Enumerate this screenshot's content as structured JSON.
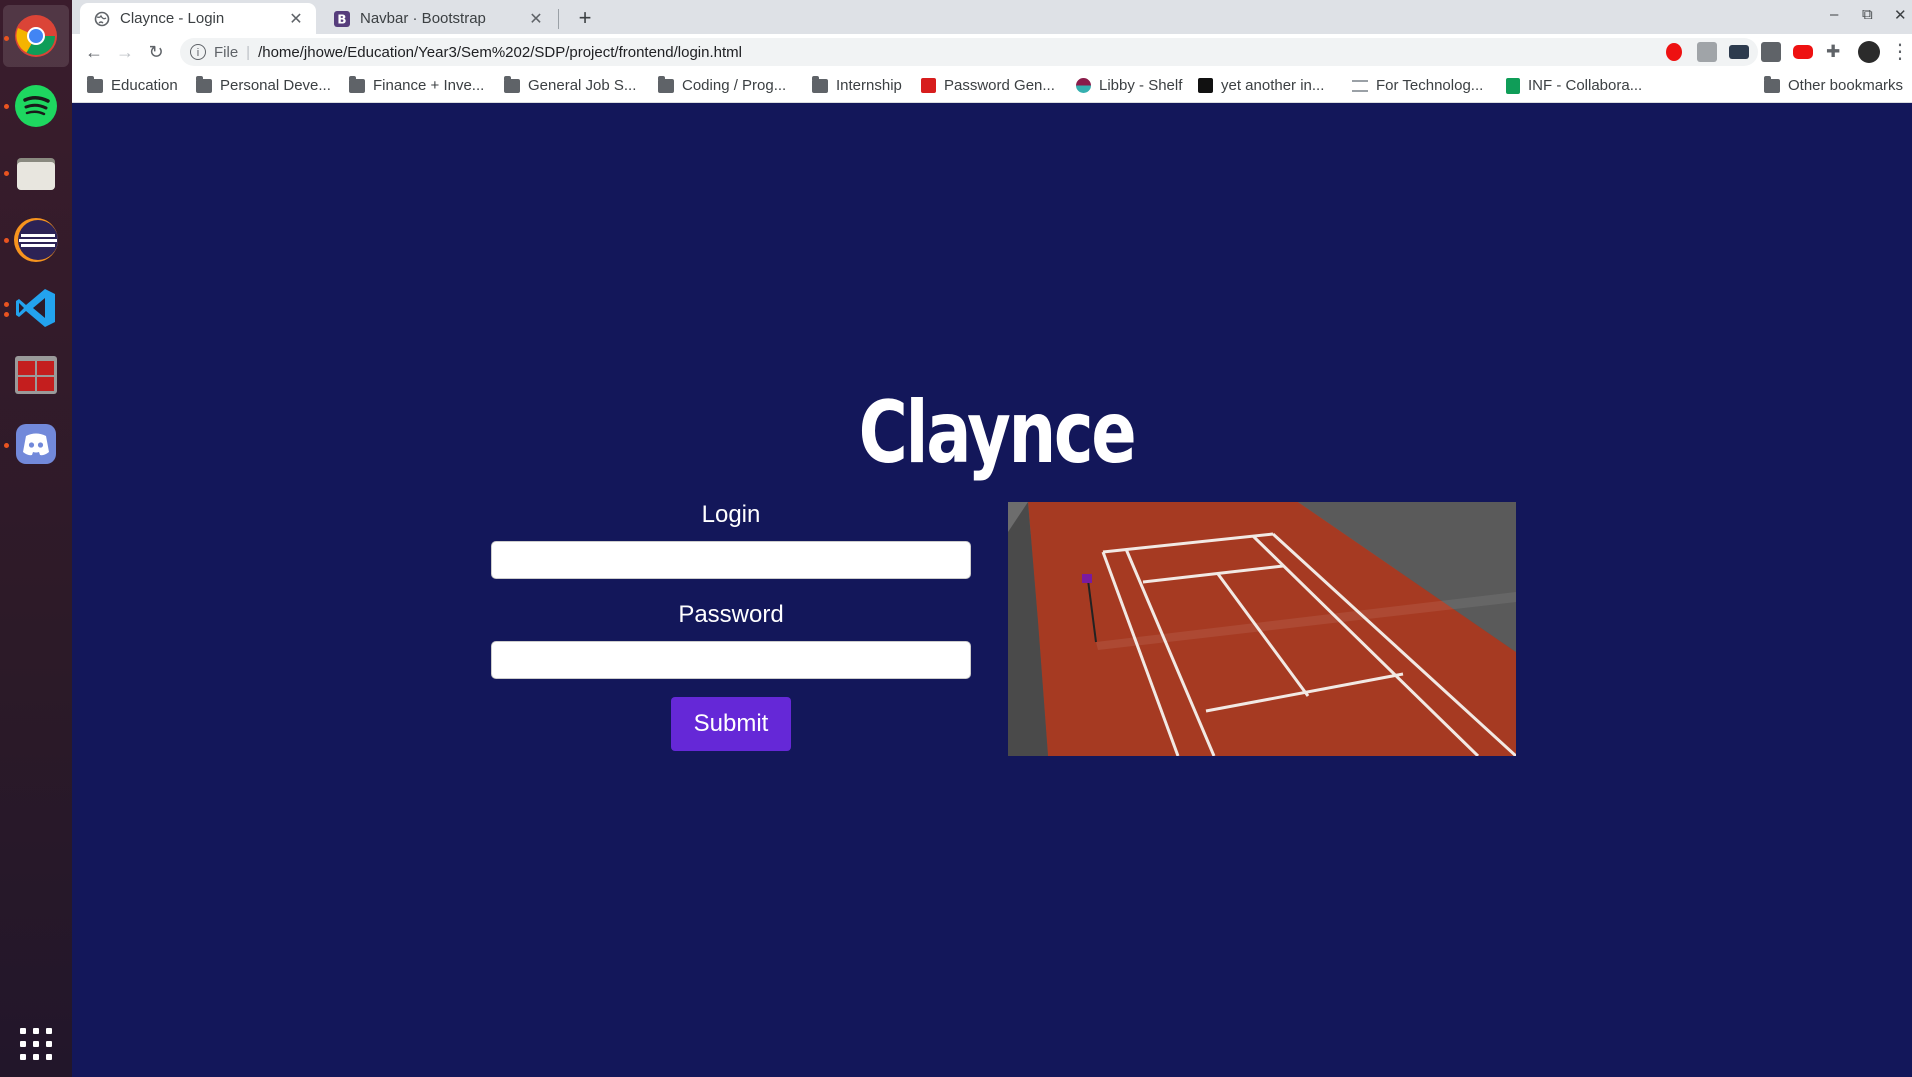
{
  "browser": {
    "tabs": [
      {
        "title": "Claynce - Login",
        "active": true
      },
      {
        "title": "Navbar · Bootstrap",
        "active": false
      }
    ],
    "new_tab_label": "+",
    "window_controls": {
      "minimize": "–",
      "restore": "⧉",
      "close": "✕"
    }
  },
  "toolbar": {
    "back": "←",
    "forward": "→",
    "reload": "↻",
    "scheme": "File",
    "url": "/home/jhowe/Education/Year3/Sem%202/SDP/project/frontend/login.html",
    "star": "☆",
    "menu": "⋮"
  },
  "bookmarks": [
    {
      "label": "Education",
      "icon": "folder-icon"
    },
    {
      "label": "Personal Deve...",
      "icon": "folder-icon"
    },
    {
      "label": "Finance + Inve...",
      "icon": "folder-icon"
    },
    {
      "label": "General Job S...",
      "icon": "folder-icon"
    },
    {
      "label": "Coding / Prog...",
      "icon": "folder-icon"
    },
    {
      "label": "Internship",
      "icon": "folder-icon"
    },
    {
      "label": "Password Gen...",
      "icon": "password-gen-icon"
    },
    {
      "label": "Libby - Shelf",
      "icon": "libby-icon"
    },
    {
      "label": "yet another in...",
      "icon": "terminal-icon"
    },
    {
      "label": "For Technolog...",
      "icon": "page-icon"
    },
    {
      "label": "INF - Collabora...",
      "icon": "sheets-icon"
    },
    {
      "label": "Other bookmarks",
      "icon": "folder-icon"
    }
  ],
  "page": {
    "brand": "Claynce",
    "login_label": "Login",
    "password_label": "Password",
    "submit_label": "Submit",
    "login_value": "",
    "password_value": ""
  },
  "colors": {
    "page_bg": "#13175a",
    "submit_bg": "#6528d7",
    "court_clay": "#a63a22",
    "dock_accent": "#e95420"
  }
}
